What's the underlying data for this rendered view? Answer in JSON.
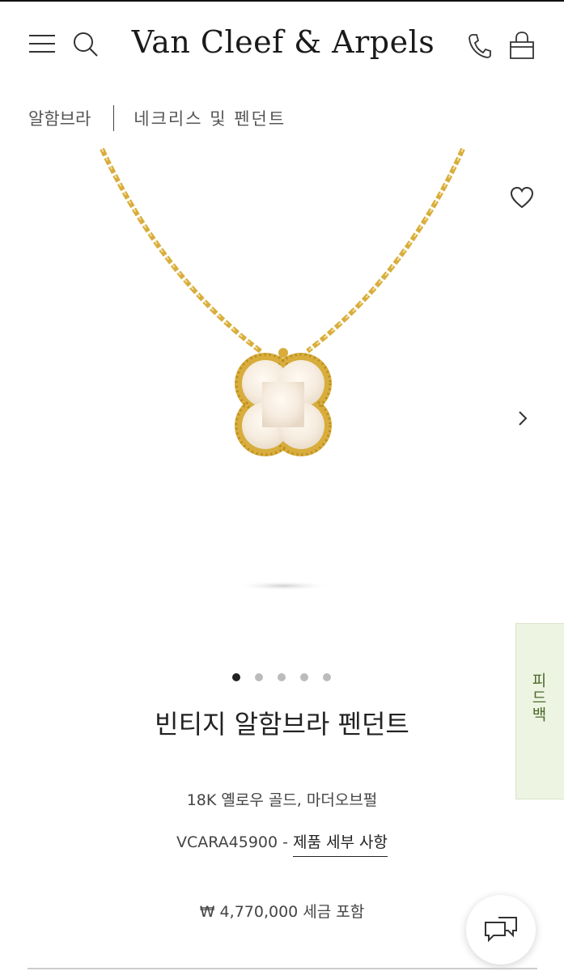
{
  "header": {
    "brand": "Van Cleef & Arpels",
    "icons": [
      "menu-icon",
      "search-icon",
      "phone-icon",
      "shopping-bag-icon"
    ]
  },
  "breadcrumb": {
    "items": [
      "알함브라",
      "네크리스 및 펜던트"
    ]
  },
  "gallery": {
    "image_count": 5,
    "active_index": 0,
    "icons": [
      "heart-icon",
      "chevron-right-icon"
    ]
  },
  "product": {
    "title": "빈티지 알함브라 펜던트",
    "material": "18K 옐로우 골드, 마더오브펄",
    "reference": "VCARA45900 - ",
    "details_link": "제품 세부 사항",
    "price": "₩ 4,770,000 세금 포함"
  },
  "feedback_tab": {
    "label": "피드백"
  },
  "colors": {
    "gold": "#d8ad3c",
    "feedback_bg": "#eef4e2",
    "feedback_text": "#4b6a2a"
  }
}
